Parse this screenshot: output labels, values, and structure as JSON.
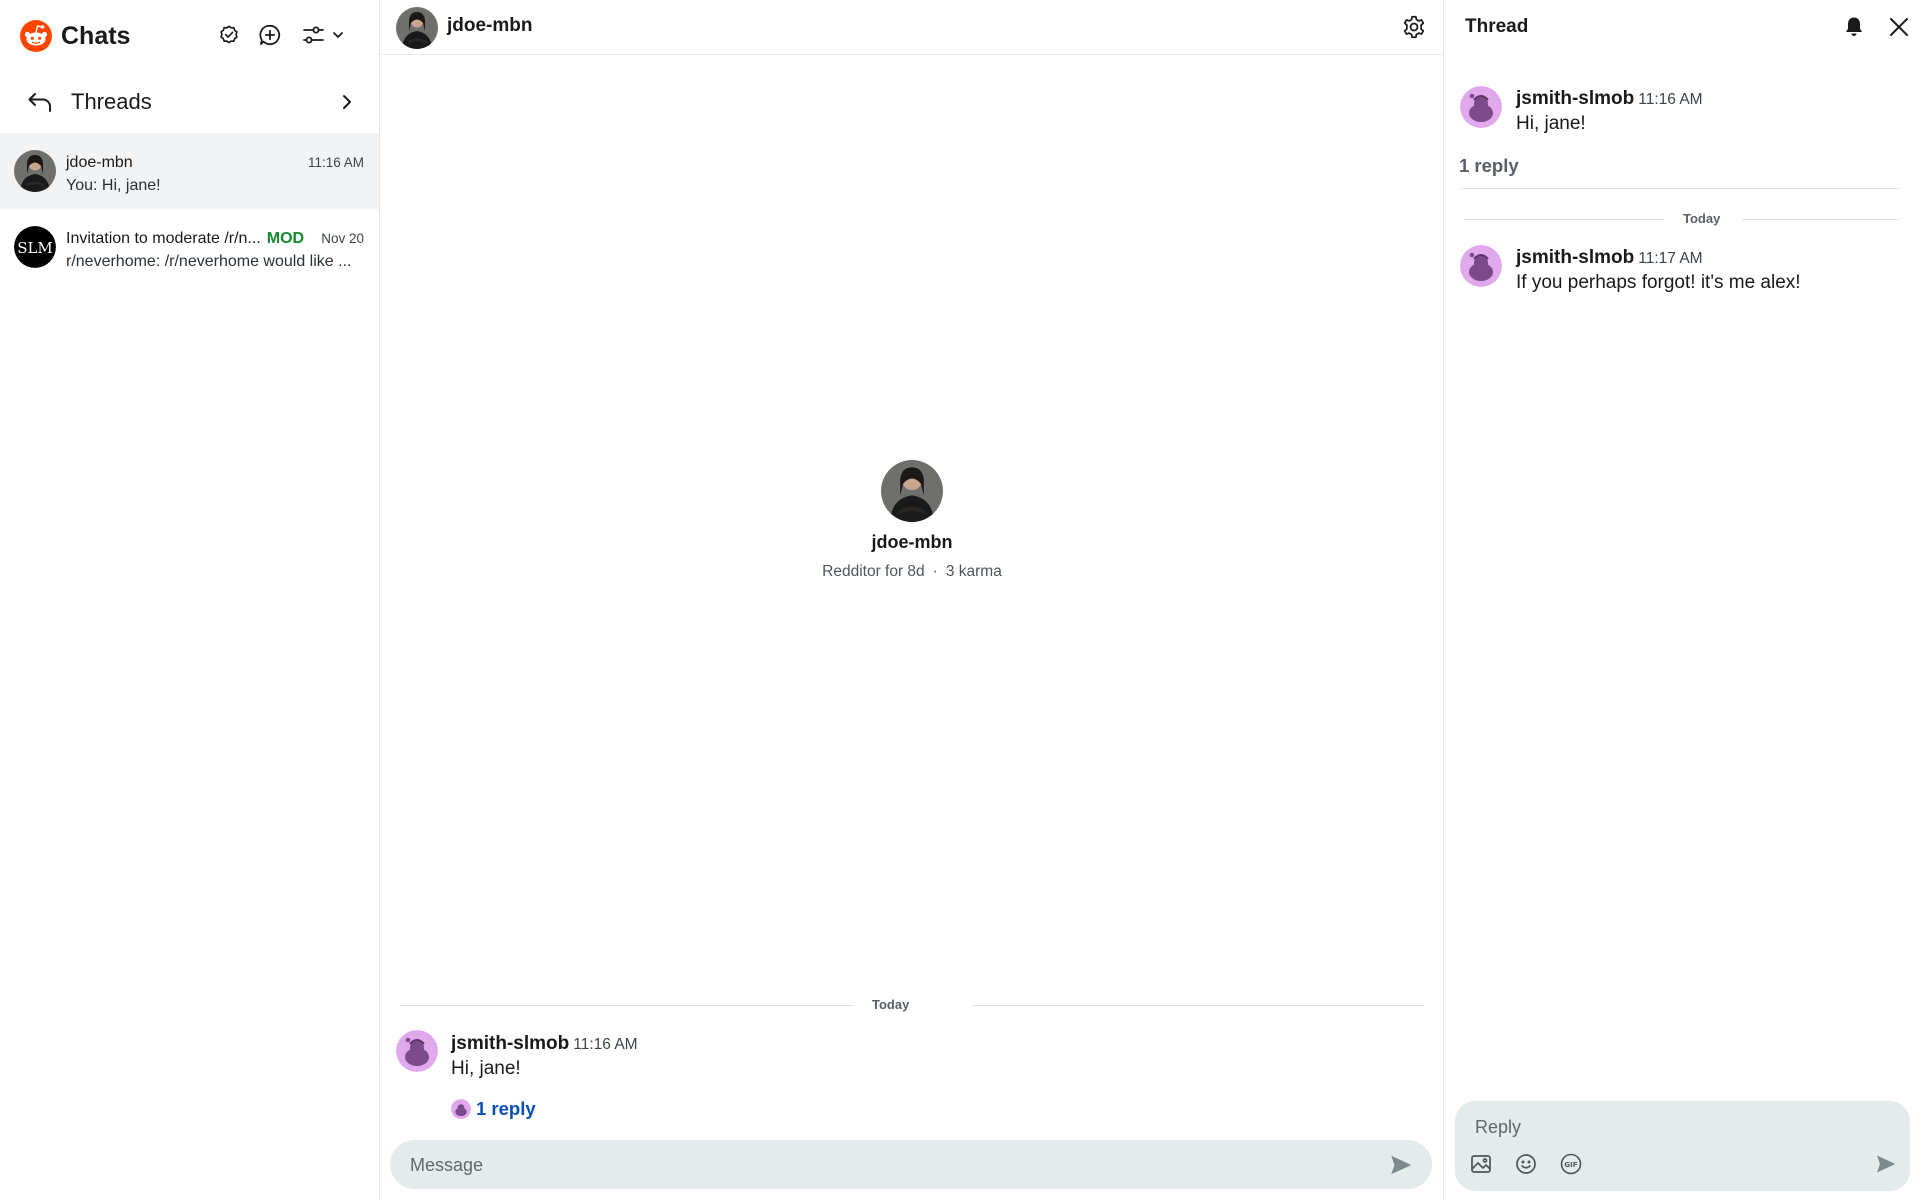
{
  "sidebar": {
    "title": "Chats",
    "threads_label": "Threads",
    "chats": [
      {
        "name": "jdoe-mbn",
        "time": "11:16 AM",
        "preview": "You: Hi, jane!"
      },
      {
        "name": "Invitation to moderate /r/n...",
        "badge": "MOD",
        "time": "Nov 20",
        "preview": "r/neverhome: /r/neverhome would like ...",
        "avatar_text": "SLM"
      }
    ]
  },
  "main": {
    "header_name": "jdoe-mbn",
    "profile": {
      "name": "jdoe-mbn",
      "age": "Redditor for 8d",
      "separator": "·",
      "karma": "3 karma"
    },
    "day_label": "Today",
    "message": {
      "author": "jsmith-slmob",
      "time": "11:16 AM",
      "text": "Hi, jane!"
    },
    "reply_link": "1 reply",
    "composer_placeholder": "Message"
  },
  "thread": {
    "title": "Thread",
    "parent": {
      "author": "jsmith-slmob",
      "time": "11:16 AM",
      "text": "Hi, jane!"
    },
    "replies_count": "1 reply",
    "day_label": "Today",
    "reply": {
      "author": "jsmith-slmob",
      "time": "11:17 AM",
      "text": "If you perhaps forgot! it's me alex!"
    },
    "reply_placeholder": "Reply"
  },
  "icons": {
    "brand": "reddit-logo-icon",
    "mark_read": "check-badge-icon",
    "new_chat": "plus-bubble-icon",
    "filter": "filter-sliders-icon",
    "back": "reply-arrow-icon",
    "chevron": "chevron-right-icon",
    "settings": "gear-icon",
    "notifications": "bell-icon",
    "close": "close-icon",
    "send": "send-icon",
    "image": "image-icon",
    "emoji": "emoji-icon",
    "gif": "gif-icon"
  },
  "colors": {
    "brand": "#ff4500",
    "mod_badge": "#168a2e",
    "link": "#0b4fb3",
    "active_item": "#f1f3f5",
    "composer_bg": "#e4ebec"
  }
}
